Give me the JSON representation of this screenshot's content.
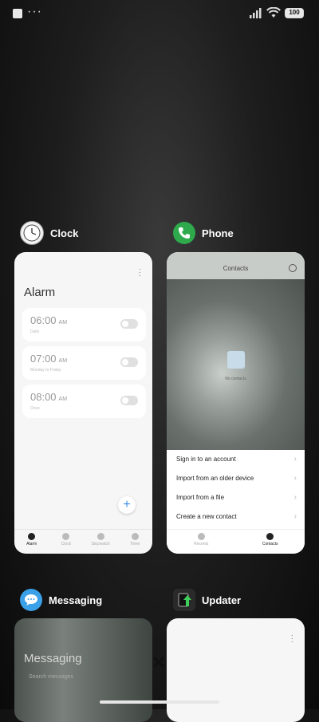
{
  "status_bar": {
    "battery": "100",
    "dots": "···"
  },
  "apps": {
    "clock": {
      "name": "Clock",
      "screen_title": "Alarm",
      "alarms": [
        {
          "time": "06:00",
          "ampm": "AM",
          "sub": "Daily"
        },
        {
          "time": "07:00",
          "ampm": "AM",
          "sub": "Monday to Friday"
        },
        {
          "time": "08:00",
          "ampm": "AM",
          "sub": "Once"
        }
      ],
      "fab": "+",
      "nav": [
        "Alarm",
        "Clock",
        "Stopwatch",
        "Timer"
      ]
    },
    "phone": {
      "name": "Phone",
      "screen_title": "Contacts",
      "empty_text": "No contacts",
      "menu": [
        "Sign in to an account",
        "Import from an older device",
        "Import from a file",
        "Create a new contact"
      ],
      "nav": [
        "Recents",
        "Contacts"
      ]
    },
    "messaging": {
      "name": "Messaging",
      "screen_title": "Messaging",
      "search": "Search messages"
    },
    "updater": {
      "name": "Updater"
    }
  },
  "close_glyph": "✕"
}
